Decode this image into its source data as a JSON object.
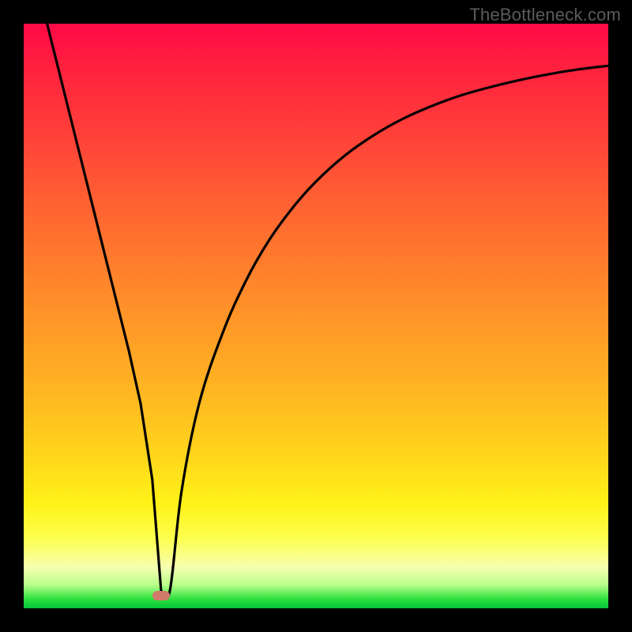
{
  "watermark": {
    "text": "TheBottleneck.com"
  },
  "colors": {
    "curve_stroke": "#000000",
    "bump_fill": "#d07a6b",
    "gradient_stops": [
      "#ff0a47",
      "#ff1f3f",
      "#ff4338",
      "#ff6a30",
      "#ff8f29",
      "#ffb322",
      "#ffd61c",
      "#fff217",
      "#fdff4e",
      "#f6ffb0",
      "#b8ff8a",
      "#29e03c",
      "#05c63b"
    ]
  },
  "chart_data": {
    "type": "line",
    "title": "",
    "xlabel": "",
    "ylabel": "",
    "xlim": [
      0,
      100
    ],
    "ylim": [
      0,
      100
    ],
    "grid": false,
    "legend": false,
    "series": [
      {
        "name": "curve",
        "x": [
          4,
          6,
          8,
          10,
          12,
          14,
          16,
          18,
          20,
          22,
          23.5,
          25,
          27,
          30,
          34,
          38,
          42,
          46,
          50,
          55,
          60,
          65,
          70,
          75,
          80,
          85,
          90,
          95,
          100
        ],
        "values": [
          100,
          92,
          84,
          76,
          68,
          60,
          52,
          44,
          35,
          22,
          3,
          3,
          20,
          35,
          47,
          56,
          63,
          68.5,
          73,
          77.5,
          81,
          83.8,
          86,
          87.8,
          89.2,
          90.4,
          91.4,
          92.2,
          92.8
        ]
      }
    ],
    "annotations": [
      {
        "name": "bump-marker",
        "x": 23.5,
        "y": 2.2
      }
    ]
  }
}
